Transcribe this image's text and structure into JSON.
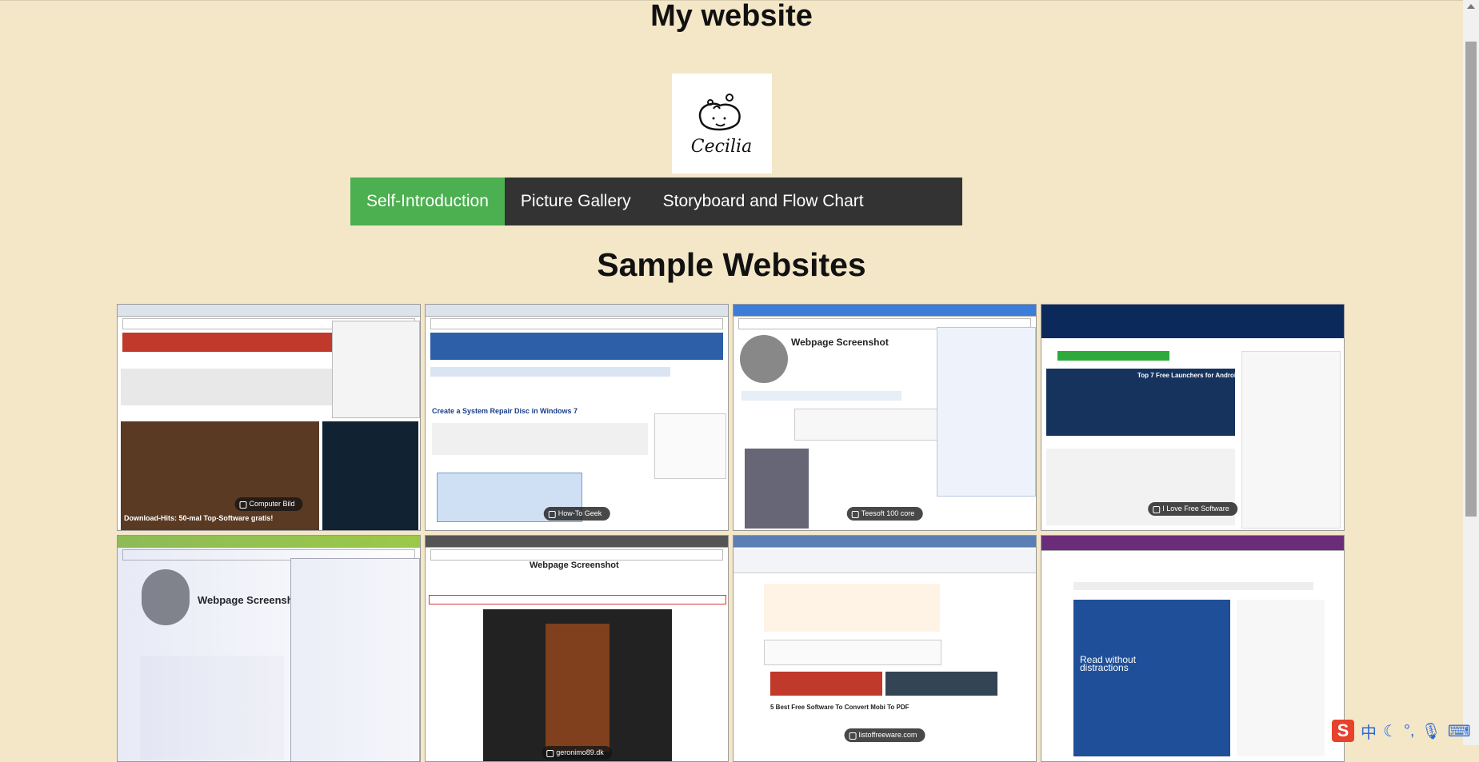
{
  "site": {
    "title": "My website",
    "logo_text": "Cecilia"
  },
  "nav": {
    "items": [
      {
        "label": "Self-Introduction",
        "active": true
      },
      {
        "label": "Picture Gallery",
        "active": false
      },
      {
        "label": "Storyboard and Flow Chart",
        "active": false
      }
    ],
    "active_color": "#4caf50",
    "bar_color": "#333333"
  },
  "section": {
    "title": "Sample Websites"
  },
  "gallery": {
    "items": [
      {
        "caption": "Computer Bild",
        "heading": "Download-Hits: 50-mal Top-Software gratis!",
        "theme": "#c0392b"
      },
      {
        "caption": "How-To Geek",
        "heading": "Create a System Repair Disc in Windows 7",
        "theme": "#2c5fa8"
      },
      {
        "caption": "Teesoft 100 core",
        "heading": "Webpage Screenshot",
        "theme": "#3b7dd8"
      },
      {
        "caption": "I Love Free Software",
        "heading": "Top 7 Free Launchers for Android",
        "theme": "#0b2a5b"
      },
      {
        "caption": "",
        "heading": "Webpage Screenshot",
        "theme": "#3a5bb0"
      },
      {
        "caption": "geronimo89.dk",
        "heading": "Webpage Screenshot",
        "theme": "#222222"
      },
      {
        "caption": "listoffreeware.com",
        "heading": "5 Best Free Software To Convert Mobi To PDF",
        "theme": "#e27a1a"
      },
      {
        "caption": "",
        "heading": "Read without distractions",
        "theme": "#6b2d7a"
      }
    ]
  },
  "ime": {
    "logo": "S",
    "lang": "中"
  },
  "colors": {
    "background": "#f4e7c8"
  }
}
